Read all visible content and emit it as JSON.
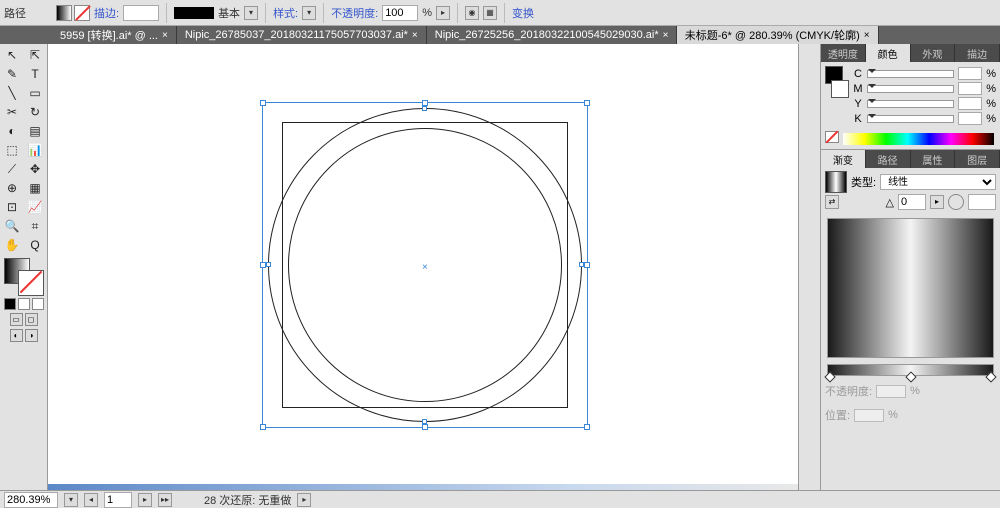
{
  "optbar": {
    "path_label": "路径",
    "stroke_label": "描边:",
    "basic_label": "基本",
    "style_label": "样式:",
    "opacity_label": "不透明度:",
    "opacity_value": "100",
    "transform_label": "变换"
  },
  "tabs": [
    {
      "label": "5959 [转换].ai* @ ...",
      "active": false
    },
    {
      "label": "Nipic_26785037_20180321175057703037.ai* ",
      "active": false
    },
    {
      "label": "Nipic_26725256_20180322100545029030.ai* ",
      "active": false
    },
    {
      "label": "未标题-6* @ 280.39% (CMYK/轮廓)",
      "active": true
    }
  ],
  "panels": {
    "color_tabs": [
      "透明度",
      "颜色",
      "外观",
      "描边"
    ],
    "color_active": 1,
    "channels": [
      "C",
      "M",
      "Y",
      "K"
    ],
    "grad_tabs": [
      "渐变",
      "路径",
      "属性",
      "图层"
    ],
    "grad_type_label": "类型:",
    "grad_type_value": "线性",
    "angle_value": "0",
    "opacity_label": "不透明度:",
    "location_label": "位置:"
  },
  "status": {
    "zoom": "280.39%",
    "page": "1",
    "undo_text": "28 次还原: 无重做"
  },
  "tool_glyphs": [
    "↖",
    "⇱",
    "✎",
    "T",
    "╲",
    "▭",
    "✂",
    "↻",
    "◐",
    "▤",
    "⬚",
    "📊",
    "⟋",
    "✥",
    "⊕",
    "▦",
    "⊡",
    "📈",
    "🔍",
    "⌗",
    "✋",
    "Q",
    "◫",
    "✧"
  ]
}
